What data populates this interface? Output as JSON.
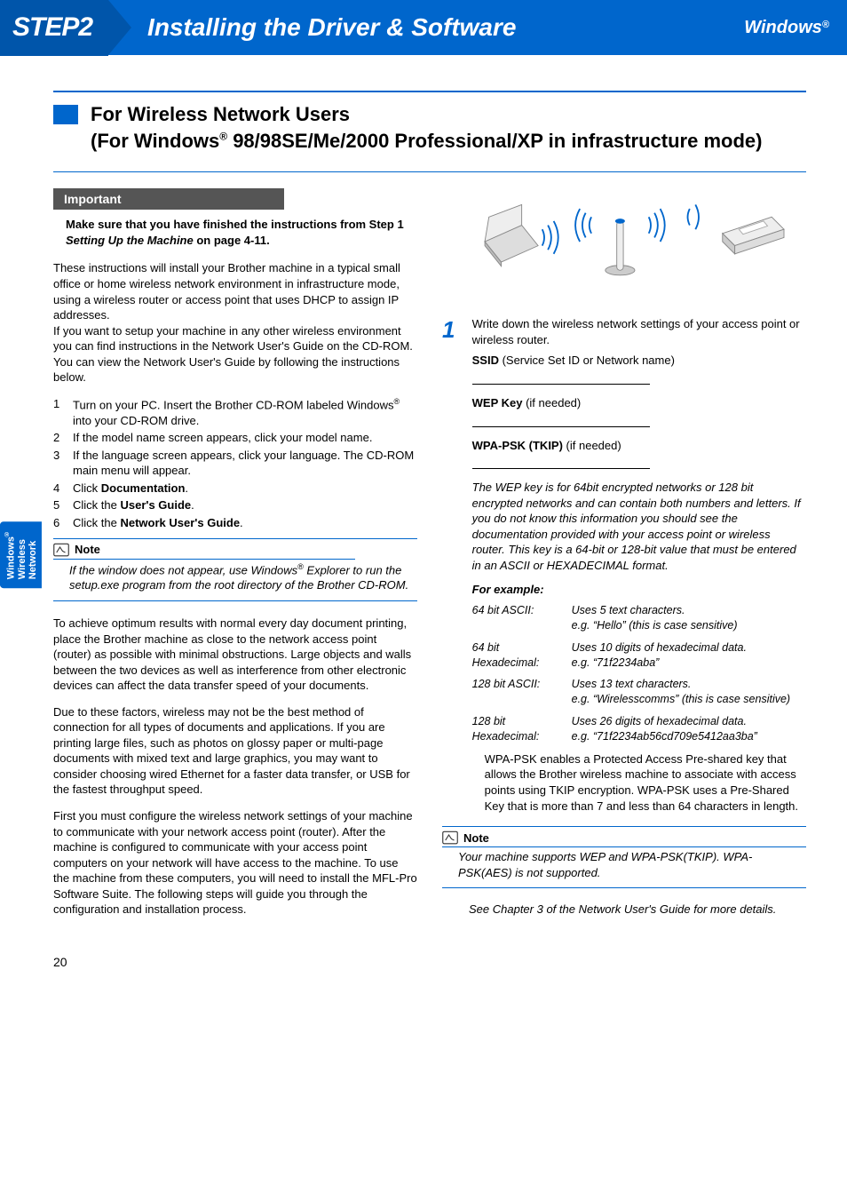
{
  "header": {
    "step": "STEP2",
    "title": "Installing the Driver & Software",
    "os": "Windows",
    "reg": "®"
  },
  "sideTab": {
    "line1": "Windows",
    "reg": "®",
    "line2": "Wireless",
    "line3": "Network"
  },
  "section": {
    "title1": "For Wireless Network Users",
    "title2a": "(For Windows",
    "reg": "®",
    "title2b": " 98/98SE/Me/2000 Professional/XP in infrastructure mode)"
  },
  "important": {
    "label": "Important",
    "text_a": "Make sure that you have finished the instructions from Step 1 ",
    "text_em": "Setting Up the Machine",
    "text_b": " on page 4-11."
  },
  "leftCol": {
    "intro": "These instructions will install your Brother machine in a typical small office or home wireless network environment in infrastructure mode, using a wireless router or access point that uses DHCP to assign IP addresses.",
    "intro2": "If you want to setup your machine in any other wireless environment you can find instructions in the Network User's Guide on the CD-ROM.",
    "intro3": "You can view the Network User's Guide by following the instructions below.",
    "list": {
      "i1a": "Turn on your PC. Insert the Brother CD-ROM labeled Windows",
      "reg": "®",
      "i1b": " into your CD-ROM drive.",
      "i2": "If the model name screen appears, click your model name.",
      "i3": "If the language screen appears, click your language. The CD-ROM main menu will appear.",
      "i4a": "Click ",
      "i4b": "Documentation",
      "i4c": ".",
      "i5a": "Click the ",
      "i5b": "User's Guide",
      "i5c": ".",
      "i6a": "Click the ",
      "i6b": "Network User's Guide",
      "i6c": "."
    },
    "note": {
      "label": "Note",
      "body_a": "If the window does not appear, use Windows",
      "reg": "®",
      "body_b": " Explorer to run the setup.exe program from the root directory of the Brother CD-ROM."
    },
    "p1": "To achieve optimum results with normal every day document printing, place the Brother machine as close to the network access point (router) as possible with minimal obstructions. Large objects and walls between the two devices as well as interference from other electronic devices can affect the data transfer speed of your documents.",
    "p2": "Due to these factors, wireless may not be the best method of connection for all types of documents and applications. If you are printing large files, such as photos on glossy paper or multi-page documents with mixed text and large graphics, you may want to consider choosing wired Ethernet for a faster data transfer, or USB for the fastest throughput speed.",
    "p3": "First you must configure the wireless network settings of your machine to communicate with your network access point (router). After the machine is configured to communicate with your access point computers on your network will have access to the machine. To use the machine from these computers, you will need to install the MFL-Pro Software Suite. The following steps will guide you through the configuration and installation process."
  },
  "rightCol": {
    "stepNum": "1",
    "stepText": "Write down the wireless network settings of your access point or wireless router.",
    "ssid_b": "SSID",
    "ssid_rest": " (Service Set ID or Network name)",
    "wep_b": "WEP Key",
    "wep_rest": " (if needed)",
    "wpa_b": "WPA-PSK (TKIP)",
    "wpa_rest": "  (if needed)",
    "wepExplain": "The WEP key is for 64bit encrypted networks or 128 bit encrypted networks and can contain both numbers and letters. If you do not know this information you should see the documentation provided with your access point or wireless router. This key is a 64-bit or 128-bit value that must be entered in an ASCII or HEXADECIMAL format.",
    "exampleLabel": "For example:",
    "examples": [
      {
        "k": "64 bit ASCII:",
        "v": "Uses 5 text characters.\ne.g. “Hello” (this is case sensitive)"
      },
      {
        "k": "64 bit Hexadecimal:",
        "v": "Uses 10 digits of hexadecimal data.\ne.g. “71f2234aba”"
      },
      {
        "k": "128 bit ASCII:",
        "v": "Uses 13 text characters.\ne.g. “Wirelesscomms” (this is case sensitive)"
      },
      {
        "k": "128 bit Hexadecimal:",
        "v": "Uses 26 digits of hexadecimal data.\ne.g. “71f2234ab56cd709e5412aa3ba”"
      }
    ],
    "wpaExplain": "WPA-PSK enables a Protected Access Pre-shared key that allows the Brother wireless machine to associate with access points using TKIP encryption. WPA-PSK uses a Pre-Shared Key that is more than 7 and less than 64 characters in length.",
    "note2": {
      "label": "Note",
      "body": "Your machine supports WEP and WPA-PSK(TKIP). WPA-PSK(AES) is not supported."
    },
    "seeMore": "See Chapter 3 of the Network User's Guide for more details."
  },
  "pageNum": "20"
}
